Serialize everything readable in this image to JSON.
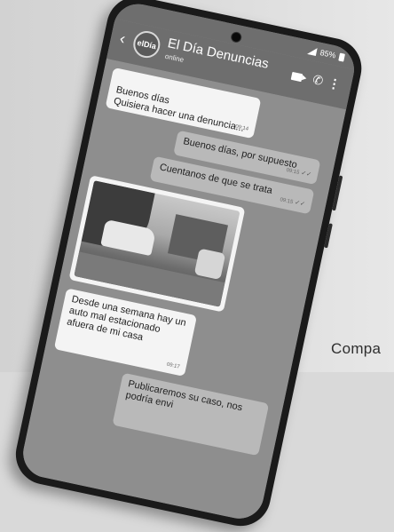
{
  "side_caption": "Compa",
  "status": {
    "battery": "85%"
  },
  "header": {
    "avatar_text": "elDía",
    "contact_name": "El Día Denuncias",
    "contact_status": "online"
  },
  "messages": [
    {
      "dir": "in",
      "text": "Buenos días\nQuisiera hacer una denuncia...",
      "time": "09:14"
    },
    {
      "dir": "out",
      "text": "Buenos días, por supuesto",
      "time": "09:15"
    },
    {
      "dir": "out",
      "text": "Cuentanos de que se trata",
      "time": "09:15"
    },
    {
      "dir": "in",
      "type": "photo",
      "time": ""
    },
    {
      "dir": "in",
      "text": "Desde una semana hay un auto mal estacionado afuera de mi casa",
      "time": "09:17"
    },
    {
      "dir": "out",
      "text": "Publicaremos su caso, nos podría envi",
      "time": ""
    }
  ]
}
